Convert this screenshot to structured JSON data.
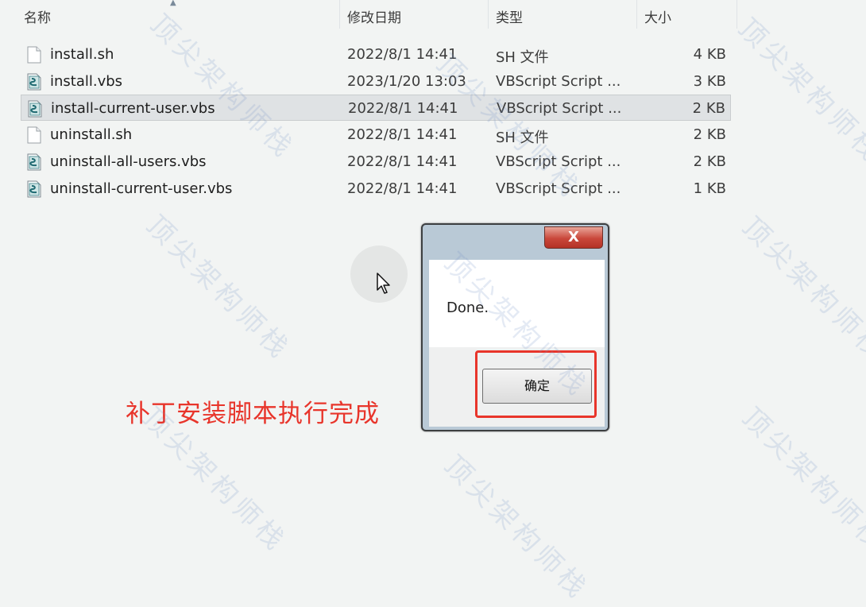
{
  "columns": {
    "name": "名称",
    "date": "修改日期",
    "type": "类型",
    "size": "大小"
  },
  "files": [
    {
      "name": "install.sh",
      "date": "2022/8/1 14:41",
      "type": "SH 文件",
      "size": "4 KB",
      "icon": "document-icon"
    },
    {
      "name": "install.vbs",
      "date": "2023/1/20 13:03",
      "type": "VBScript Script ...",
      "size": "3 KB",
      "icon": "vbscript-file-icon"
    },
    {
      "name": "install-current-user.vbs",
      "date": "2022/8/1 14:41",
      "type": "VBScript Script ...",
      "size": "2 KB",
      "icon": "vbscript-file-icon",
      "selected": true
    },
    {
      "name": "uninstall.sh",
      "date": "2022/8/1 14:41",
      "type": "SH 文件",
      "size": "2 KB",
      "icon": "document-icon"
    },
    {
      "name": "uninstall-all-users.vbs",
      "date": "2022/8/1 14:41",
      "type": "VBScript Script ...",
      "size": "2 KB",
      "icon": "vbscript-file-icon"
    },
    {
      "name": "uninstall-current-user.vbs",
      "date": "2022/8/1 14:41",
      "type": "VBScript Script ...",
      "size": "1 KB",
      "icon": "vbscript-file-icon"
    }
  ],
  "dialog": {
    "close_label": "X",
    "message": "Done.",
    "ok_label": "确定"
  },
  "annotation": "补丁安装脚本执行完成",
  "watermark": "顶尖架构师栈",
  "colors": {
    "annotation": "#e8352b",
    "selection": "#dfe2e4",
    "close_button": "#c9473a"
  }
}
